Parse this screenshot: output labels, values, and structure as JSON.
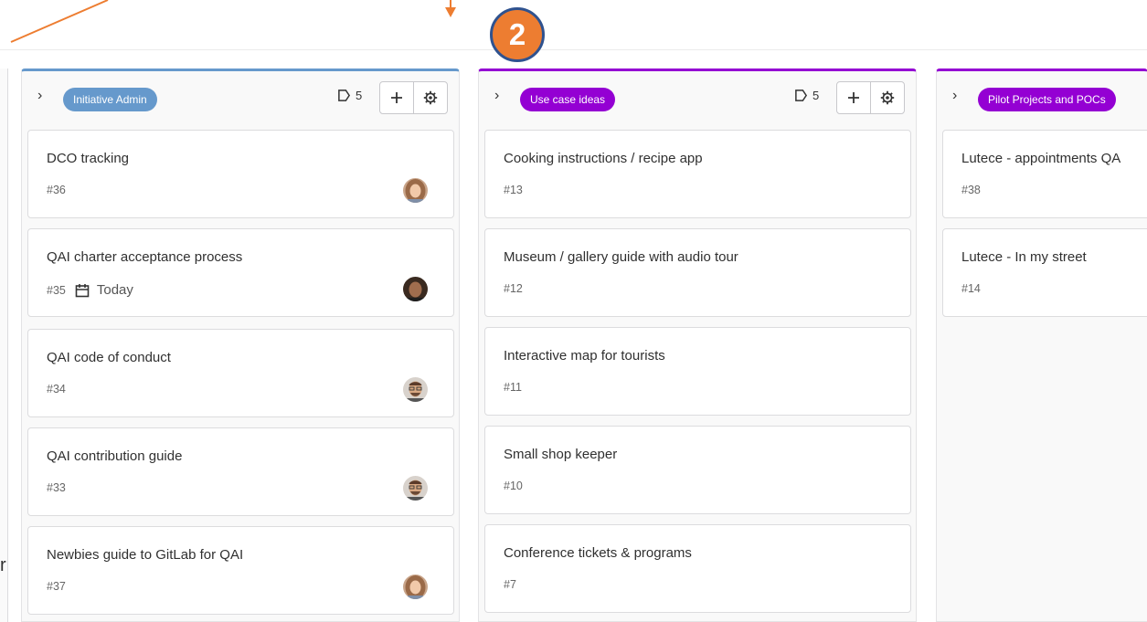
{
  "annotation": {
    "step_number": "2",
    "accent_color": "#ed7d31",
    "badge_border_color": "#2f528f"
  },
  "edge": {
    "fragment": "r"
  },
  "lists": [
    {
      "label": "Initiative Admin",
      "label_color": "#6699cc",
      "top_border_color": "#6699cc",
      "issue_count": "5",
      "issues": [
        {
          "title": "DCO tracking",
          "ref": "#36",
          "avatar": "female"
        },
        {
          "title": "QAI charter acceptance process",
          "ref": "#35",
          "due": "Today",
          "avatar": "male-dark"
        },
        {
          "title": "QAI code of conduct",
          "ref": "#34",
          "avatar": "male-glasses"
        },
        {
          "title": "QAI contribution guide",
          "ref": "#33",
          "avatar": "male-glasses"
        },
        {
          "title": "Newbies guide to GitLab for QAI",
          "ref": "#37",
          "avatar": "female"
        }
      ]
    },
    {
      "label": "Use case ideas",
      "label_color": "#9400d3",
      "top_border_color": "#9400d3",
      "issue_count": "5",
      "issues": [
        {
          "title": "Cooking instructions / recipe app",
          "ref": "#13"
        },
        {
          "title": "Museum / gallery guide with audio tour",
          "ref": "#12"
        },
        {
          "title": "Interactive map for tourists",
          "ref": "#11"
        },
        {
          "title": "Small shop keeper",
          "ref": "#10"
        },
        {
          "title": "Conference tickets & programs",
          "ref": "#7"
        }
      ]
    },
    {
      "label": "Pilot Projects and POCs",
      "label_color": "#9400d3",
      "top_border_color": "#9400d3",
      "issues": [
        {
          "title": "Lutece - appointments QA",
          "ref": "#38"
        },
        {
          "title": "Lutece - In my street",
          "ref": "#14"
        }
      ]
    }
  ]
}
